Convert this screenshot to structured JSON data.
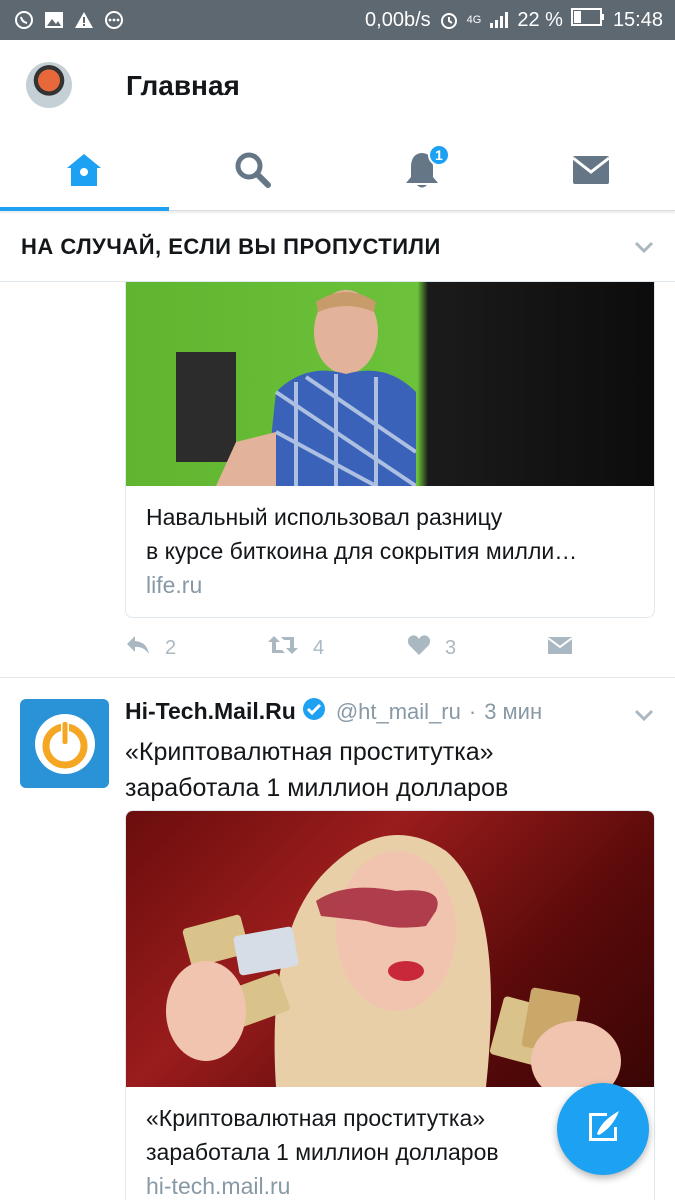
{
  "status_bar": {
    "network_speed": "0,00b/s",
    "network_type": "4G",
    "battery": "22 %",
    "time": "15:48",
    "icons": [
      "whatsapp-icon",
      "image-icon",
      "warning-icon",
      "more-icon",
      "alarm-icon",
      "signal-icon",
      "battery-icon"
    ]
  },
  "header": {
    "title": "Главная"
  },
  "tabs": [
    {
      "name": "home",
      "icon": "home-icon",
      "active": true
    },
    {
      "name": "search",
      "icon": "search-icon",
      "active": false
    },
    {
      "name": "notifications",
      "icon": "bell-icon",
      "active": false,
      "badge": "1"
    },
    {
      "name": "messages",
      "icon": "envelope-icon",
      "active": false
    }
  ],
  "section": {
    "title": "НА СЛУЧАЙ, ЕСЛИ ВЫ ПРОПУСТИЛИ"
  },
  "tweet1": {
    "card": {
      "title_line1": "Навальный использовал разницу",
      "title_line2": "в курсе биткоина для сокрытия милли…",
      "url": "life.ru"
    },
    "actions": {
      "replies": "2",
      "retweets": "4",
      "likes": "3"
    }
  },
  "tweet2": {
    "name": "Hi-Tech.Mail.Ru",
    "handle": "@ht_mail_ru",
    "separator": "·",
    "time": "3 мин",
    "text_line1": "«Криптовалютная проститутка»",
    "text_line2": "заработала 1 миллион долларов",
    "card": {
      "title_line1": "«Криптовалютная проститутка»",
      "title_line2": "заработала 1 миллион долларов",
      "url": "hi-tech.mail.ru"
    }
  },
  "colors": {
    "accent": "#1da1f2",
    "statusbar": "#5e6870",
    "muted": "#8899a6"
  }
}
